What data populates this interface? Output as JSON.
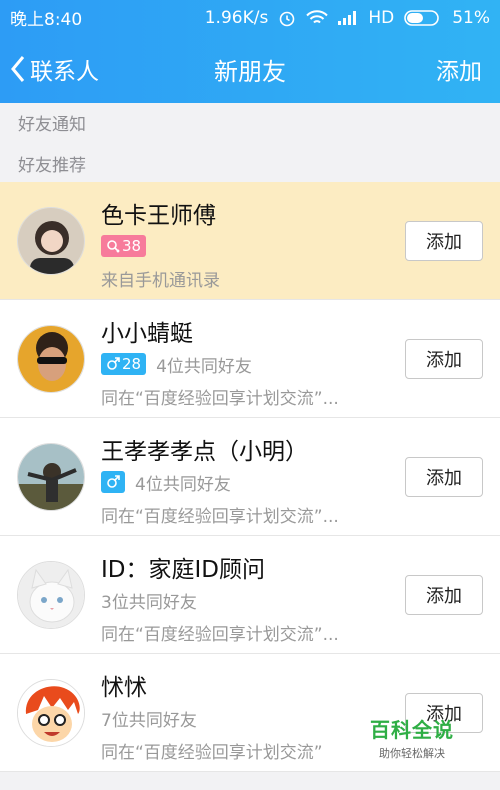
{
  "status": {
    "time": "晚上8:40",
    "speed": "1.96K/s",
    "network": "HD",
    "battery": "51%"
  },
  "nav": {
    "back_label": "联系人",
    "title": "新朋友",
    "add_label": "添加"
  },
  "sections": {
    "notice": "好友通知",
    "recommend": "好友推荐"
  },
  "rows": [
    {
      "name": "色卡王师傅",
      "badge": "38",
      "mutual": "",
      "source": "来自手机通讯录",
      "button": "添加"
    },
    {
      "name": "小小蜻蜓",
      "badge": "28",
      "mutual": "4位共同好友",
      "source": "同在“百度经验回享计划交流”...",
      "button": "添加"
    },
    {
      "name": "王孝孝孝点（小明）",
      "badge": "",
      "mutual": "4位共同好友",
      "source": "同在“百度经验回享计划交流”...",
      "button": "添加"
    },
    {
      "name": "ID：家庭ID顾问",
      "badge": "",
      "mutual": "3位共同好友",
      "source": "同在“百度经验回享计划交流”...",
      "button": "添加"
    },
    {
      "name": "怵怵",
      "badge": "",
      "mutual": "7位共同好友",
      "source": "同在“百度经验回享计划交流”",
      "button": "添加"
    }
  ],
  "watermark": {
    "main": "百科全说",
    "sub": "助你轻松解决"
  },
  "colors": {
    "header_start": "#2d9cf5",
    "header_end": "#31b3f4",
    "highlight_row": "#fcecc2",
    "pink_badge": "#f77b9b",
    "blue_badge": "#2fb3f4"
  }
}
